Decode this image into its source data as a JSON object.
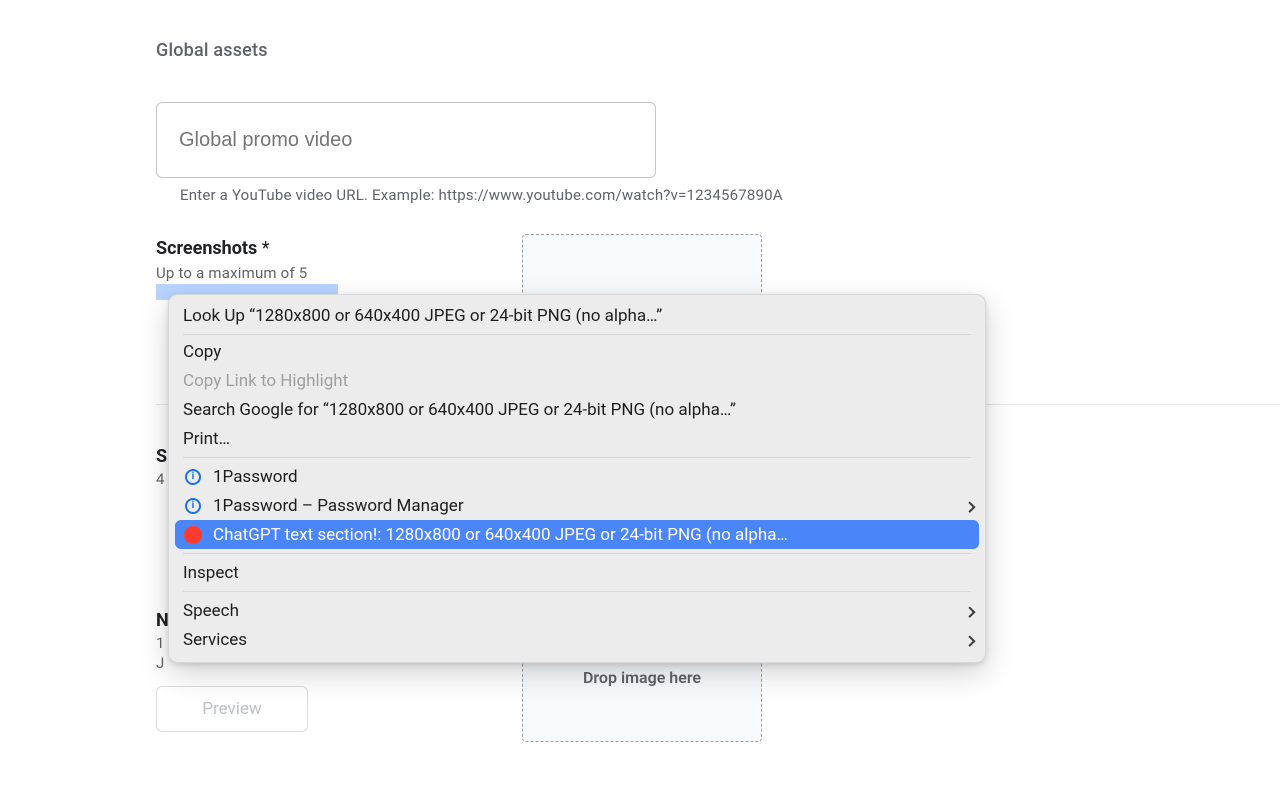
{
  "section": {
    "title": "Global assets"
  },
  "video": {
    "placeholder": "Global promo video",
    "hint": "Enter a YouTube video URL. Example: https://www.youtube.com/watch?v=1234567890A"
  },
  "screenshots": {
    "label": "Screenshots",
    "required_marker": "*",
    "subtext": "Up to a maximum of 5",
    "highlighted_fragment": "1280x800 or 640x400"
  },
  "peek": {
    "s": "S",
    "four": "4",
    "n": "N",
    "one": "1",
    "j": "J"
  },
  "preview": {
    "label": "Preview"
  },
  "dropzone": {
    "label": "Drop image here"
  },
  "context_menu": {
    "lookup": "Look Up “1280x800 or 640x400  JPEG or 24-bit PNG (no alpha…”",
    "copy": "Copy",
    "copy_link": "Copy Link to Highlight",
    "search": "Search Google for “1280x800 or 640x400  JPEG or 24-bit PNG (no alpha…”",
    "print": "Print…",
    "onepassword": "1Password",
    "onepassword_mgr": "1Password – Password Manager",
    "chatgpt": "ChatGPT text section!: 1280x800 or 640x400  JPEG or 24-bit PNG (no alpha…",
    "inspect": "Inspect",
    "speech": "Speech",
    "services": "Services"
  }
}
